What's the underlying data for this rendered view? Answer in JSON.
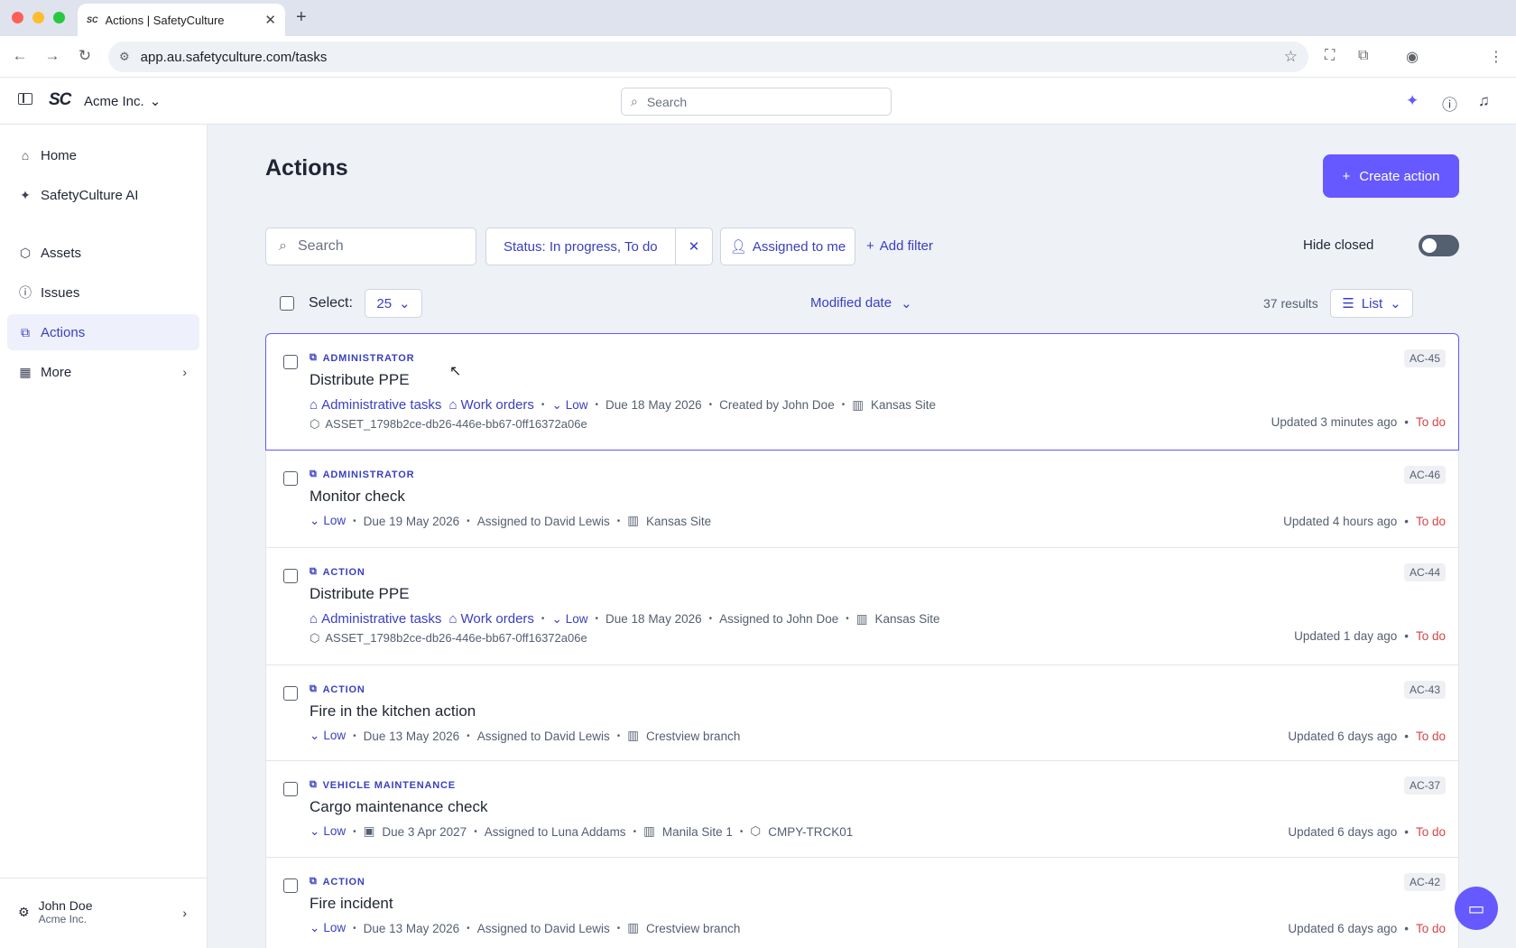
{
  "browser": {
    "tab_title": "Actions | SafetyCulture",
    "favicon": "SC",
    "url": "app.au.safetyculture.com/tasks"
  },
  "topbar": {
    "logo": "SC",
    "org_name": "Acme Inc.",
    "search_placeholder": "Search"
  },
  "sidebar": {
    "items": [
      {
        "label": "Home",
        "icon": "home-icon"
      },
      {
        "label": "SafetyCulture AI",
        "icon": "sparkle-icon"
      },
      {
        "label": "Assets",
        "icon": "cube-icon"
      },
      {
        "label": "Issues",
        "icon": "issue-icon"
      },
      {
        "label": "Actions",
        "icon": "actions-icon",
        "active": true
      },
      {
        "label": "More",
        "icon": "grid-icon"
      }
    ],
    "user": {
      "name": "John Doe",
      "org": "Acme Inc."
    }
  },
  "main": {
    "title": "Actions",
    "create_label": "Create action",
    "search_placeholder": "Search",
    "status_filter": "Status: In progress, To do",
    "assigned_filter": "Assigned to me",
    "add_filter": "Add filter",
    "hide_closed": "Hide closed",
    "select_label": "Select:",
    "page_size": "25",
    "sort_label": "Modified date",
    "results": "37 results",
    "view_label": "List"
  },
  "actions": [
    {
      "type": "ADMINISTRATOR",
      "title": "Distribute PPE",
      "id": "AC-45",
      "tags": [
        "Administrative tasks",
        "Work orders"
      ],
      "priority": "Low",
      "due": "Due 18 May 2026",
      "person": "Created by John Doe",
      "site": "Kansas Site",
      "asset": "ASSET_1798b2ce-db26-446e-bb67-0ff16372a06e",
      "updated": "Updated 3 minutes ago",
      "status": "To do"
    },
    {
      "type": "ADMINISTRATOR",
      "title": "Monitor check",
      "id": "AC-46",
      "priority": "Low",
      "due": "Due 19 May 2026",
      "person": "Assigned to David Lewis",
      "site": "Kansas Site",
      "updated": "Updated 4 hours ago",
      "status": "To do"
    },
    {
      "type": "ACTION",
      "title": "Distribute PPE",
      "id": "AC-44",
      "tags": [
        "Administrative tasks",
        "Work orders"
      ],
      "priority": "Low",
      "due": "Due 18 May 2026",
      "person": "Assigned to John Doe",
      "site": "Kansas Site",
      "asset": "ASSET_1798b2ce-db26-446e-bb67-0ff16372a06e",
      "updated": "Updated 1 day ago",
      "status": "To do"
    },
    {
      "type": "ACTION",
      "title": "Fire in the kitchen action",
      "id": "AC-43",
      "priority": "Low",
      "due": "Due 13 May 2026",
      "person": "Assigned to David Lewis",
      "site": "Crestview branch",
      "updated": "Updated 6 days ago",
      "status": "To do"
    },
    {
      "type": "VEHICLE MAINTENANCE",
      "title": "Cargo maintenance check",
      "id": "AC-37",
      "priority": "Low",
      "due": "Due 3 Apr 2027",
      "person": "Assigned to Luna Addams",
      "site": "Manila Site 1",
      "asset_inline": "CMPY-TRCK01",
      "updated": "Updated 6 days ago",
      "status": "To do"
    },
    {
      "type": "ACTION",
      "title": "Fire incident",
      "id": "AC-42",
      "priority": "Low",
      "due": "Due 13 May 2026",
      "person": "Assigned to David Lewis",
      "site": "Crestview branch",
      "updated": "Updated 6 days ago",
      "status": "To do"
    }
  ]
}
